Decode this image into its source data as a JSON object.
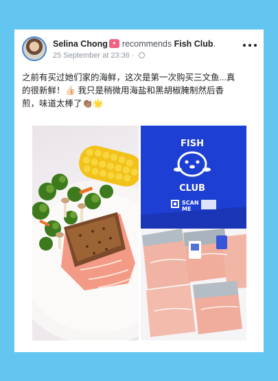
{
  "post": {
    "author": "Selina Chong",
    "recommends_text": "recommends",
    "page_name": "Fish Club",
    "page_suffix": ".",
    "timestamp": "25 September at 23:36",
    "separator": "·",
    "body_line1": "之前有买过她们家的海鲜，这次是第一次购买三文鱼...真",
    "body_line2": "的很新鲜！👍🏻 我只是稍微用海盐和黑胡椒腌制然后香",
    "body_line3": "煎，味道太棒了👏🏽🌟"
  },
  "photo_right": {
    "bag_text_top": "FISH",
    "bag_text_bottom": "CLUB",
    "scan_text": "SCAN",
    "me_text": "ME"
  },
  "colors": {
    "background": "#63c6f1",
    "avatar_ring": "#3b84d8",
    "recommend_badge": "#f06080",
    "bag_blue": "#1f3fd0"
  }
}
